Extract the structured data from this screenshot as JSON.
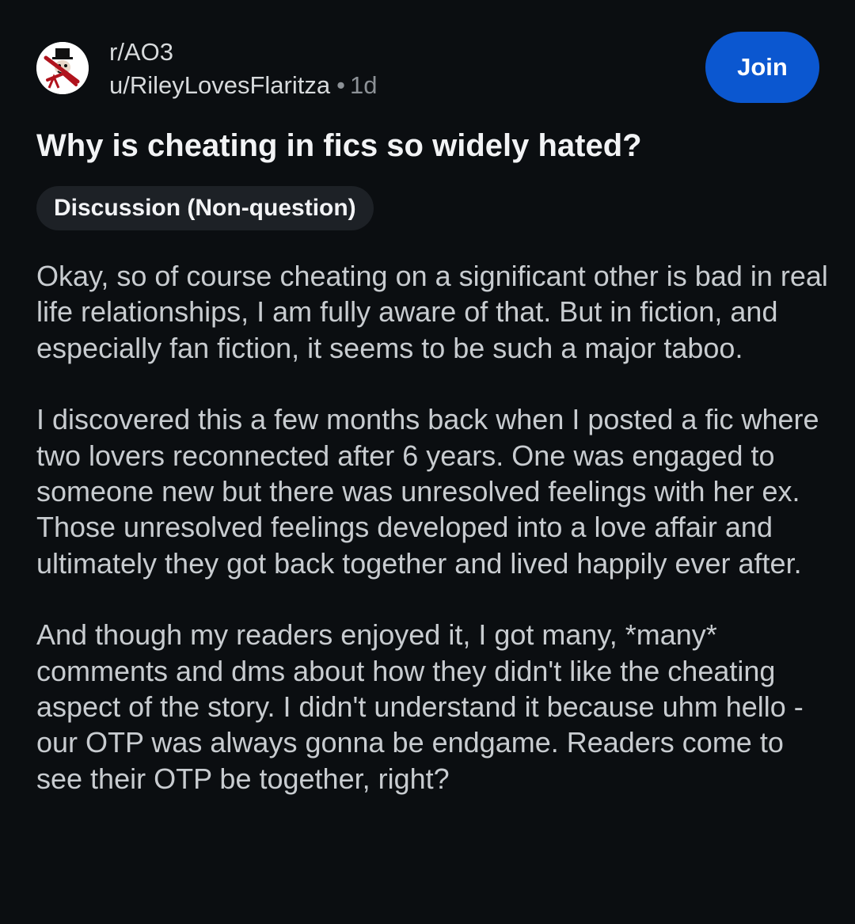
{
  "post": {
    "subreddit": "r/AO3",
    "author": "u/RileyLovesFlaritza",
    "separator": "•",
    "age": "1d",
    "join_label": "Join",
    "title": "Why is cheating in fics so widely hated?",
    "flair": "Discussion (Non-question)",
    "paragraphs": [
      "Okay, so of course cheating on a significant other is bad in real life relationships, I am fully aware of that. But in fiction, and especially fan fiction, it seems to be such a major taboo.",
      "I discovered this a few months back when I posted a fic where two lovers reconnected after 6 years. One was engaged to someone new but there was unresolved feelings with her ex. Those unresolved feelings developed into a love affair and ultimately they got back together and lived happily ever after.",
      "And though my readers enjoyed it, I got many, *many* comments and dms about how they didn't like the cheating aspect of the story. I didn't understand it because uhm hello - our OTP was always gonna be endgame. Readers come to see their OTP be together, right?"
    ]
  },
  "icons": {
    "avatar": "subreddit-avatar-icon"
  },
  "colors": {
    "background": "#0b0e11",
    "join_button": "#0b57d0",
    "flair_background": "#1d2126",
    "meta_gray": "#8c9196"
  }
}
